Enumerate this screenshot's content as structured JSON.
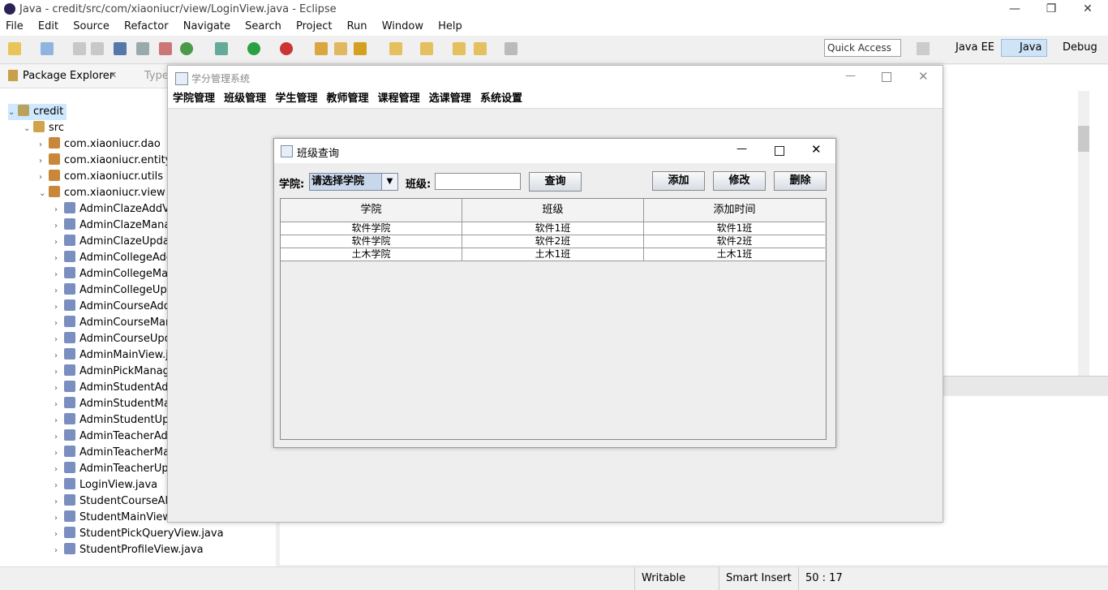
{
  "eclipse": {
    "title": "Java - credit/src/com/xiaoniucr/view/LoginView.java - Eclipse",
    "menu": [
      "File",
      "Edit",
      "Source",
      "Refactor",
      "Navigate",
      "Search",
      "Project",
      "Run",
      "Window",
      "Help"
    ],
    "quick_access": "Quick Access",
    "perspectives": [
      "Java EE",
      "Java",
      "Debug"
    ],
    "explorer_tab": "Package Explorer",
    "type_tab": "Type",
    "tree": [
      {
        "label": "credit",
        "level": 0,
        "icon": "project-icon",
        "expanded": true
      },
      {
        "label": "src",
        "level": 1,
        "icon": "source-folder-icon",
        "expanded": true
      },
      {
        "label": "com.xiaoniucr.dao",
        "level": 2,
        "icon": "package-icon"
      },
      {
        "label": "com.xiaoniucr.entity",
        "level": 2,
        "icon": "package-icon"
      },
      {
        "label": "com.xiaoniucr.utils",
        "level": 2,
        "icon": "package-icon"
      },
      {
        "label": "com.xiaoniucr.view",
        "level": 2,
        "icon": "package-icon",
        "expanded": true
      },
      {
        "label": "AdminClazeAddV",
        "level": 3,
        "icon": "java-file-icon"
      },
      {
        "label": "AdminClazeMana",
        "level": 3,
        "icon": "java-file-icon"
      },
      {
        "label": "AdminClazeUpda",
        "level": 3,
        "icon": "java-file-icon"
      },
      {
        "label": "AdminCollegeAdc",
        "level": 3,
        "icon": "java-file-icon"
      },
      {
        "label": "AdminCollegeMa",
        "level": 3,
        "icon": "java-file-icon"
      },
      {
        "label": "AdminCollegeUpc",
        "level": 3,
        "icon": "java-file-icon"
      },
      {
        "label": "AdminCourseAdd",
        "level": 3,
        "icon": "java-file-icon"
      },
      {
        "label": "AdminCourseMar",
        "level": 3,
        "icon": "java-file-icon"
      },
      {
        "label": "AdminCourseUpd",
        "level": 3,
        "icon": "java-file-icon"
      },
      {
        "label": "AdminMainView.j",
        "level": 3,
        "icon": "java-file-icon"
      },
      {
        "label": "AdminPickManag",
        "level": 3,
        "icon": "java-file-icon"
      },
      {
        "label": "AdminStudentAdc",
        "level": 3,
        "icon": "java-file-icon"
      },
      {
        "label": "AdminStudentMa",
        "level": 3,
        "icon": "java-file-icon"
      },
      {
        "label": "AdminStudentUpc",
        "level": 3,
        "icon": "java-file-icon"
      },
      {
        "label": "AdminTeacherAd",
        "level": 3,
        "icon": "java-file-icon"
      },
      {
        "label": "AdminTeacherMa",
        "level": 3,
        "icon": "java-file-icon"
      },
      {
        "label": "AdminTeacherUp",
        "level": 3,
        "icon": "java-file-icon"
      },
      {
        "label": "LoginView.java",
        "level": 3,
        "icon": "java-file-icon"
      },
      {
        "label": "StudentCourseAll",
        "level": 3,
        "icon": "java-file-icon"
      },
      {
        "label": "StudentMainView.java",
        "level": 3,
        "icon": "java-file-icon"
      },
      {
        "label": "StudentPickQueryView.java",
        "level": 3,
        "icon": "java-file-icon"
      },
      {
        "label": "StudentProfileView.java",
        "level": 3,
        "icon": "java-file-icon"
      }
    ],
    "status": {
      "writable": "Writable",
      "insert": "Smart Insert",
      "position": "50 : 17"
    },
    "colors": {
      "accent": "#3c78c8",
      "selected": "#cde8ff"
    }
  },
  "app": {
    "title": "学分管理系统",
    "menu": [
      "学院管理",
      "班级管理",
      "学生管理",
      "教师管理",
      "课程管理",
      "选课管理",
      "系统设置"
    ]
  },
  "dialog": {
    "title": "班级查询",
    "college_label": "学院:",
    "college_value": "请选择学院",
    "class_label": "班级:",
    "class_value": "",
    "query_button": "查询",
    "add_button": "添加",
    "edit_button": "修改",
    "delete_button": "删除",
    "columns": [
      "学院",
      "班级",
      "添加时间"
    ],
    "rows": [
      [
        "软件学院",
        "软件1班",
        "软件1班"
      ],
      [
        "软件学院",
        "软件2班",
        "软件2班"
      ],
      [
        "土木学院",
        "土木1班",
        "土木1班"
      ]
    ]
  }
}
